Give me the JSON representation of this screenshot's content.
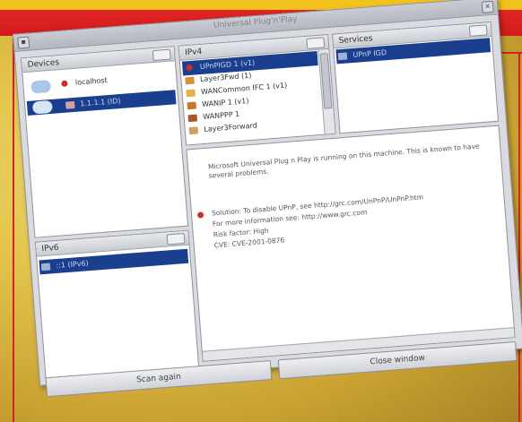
{
  "window": {
    "title": "Universal Plug'n'Play"
  },
  "devices": {
    "header": "Devices",
    "items": [
      {
        "label": "localhost"
      },
      {
        "label": "1.1.1.1 (ID)"
      }
    ]
  },
  "ipv4": {
    "header": "IPv4",
    "items": [
      {
        "label": "UPnPIGD 1 (v1)"
      },
      {
        "label": "Layer3Fwd (1)"
      },
      {
        "label": "WANCommon IFC 1 (v1)"
      },
      {
        "label": "WANIP 1 (v1)"
      },
      {
        "label": "WANPPP 1"
      },
      {
        "label": "Layer3Forward"
      }
    ]
  },
  "services": {
    "header": "Services",
    "items": [
      {
        "label": "UPnP IGD"
      }
    ]
  },
  "ipv6": {
    "header": "IPv6",
    "items": [
      {
        "label": "::1 (IPv6)"
      }
    ]
  },
  "details": {
    "intro": "Microsoft Universal Plug n Play is running on this machine. This is known to have several problems.",
    "line1": "Solution: To disable UPnP, see http://grc.com/UnPnP/UnPnP.htm",
    "line2": "For more information see: http://www.grc.com",
    "line3": "Risk factor: High",
    "line4": "CVE: CVE-2001-0876"
  },
  "buttons": {
    "left": "Scan again",
    "right": "Close window"
  },
  "colors": {
    "banner_red": "#d41a1a",
    "banner_yellow": "#f2c21f",
    "selection": "#1b3f8f",
    "alert": "#d42a2a"
  }
}
